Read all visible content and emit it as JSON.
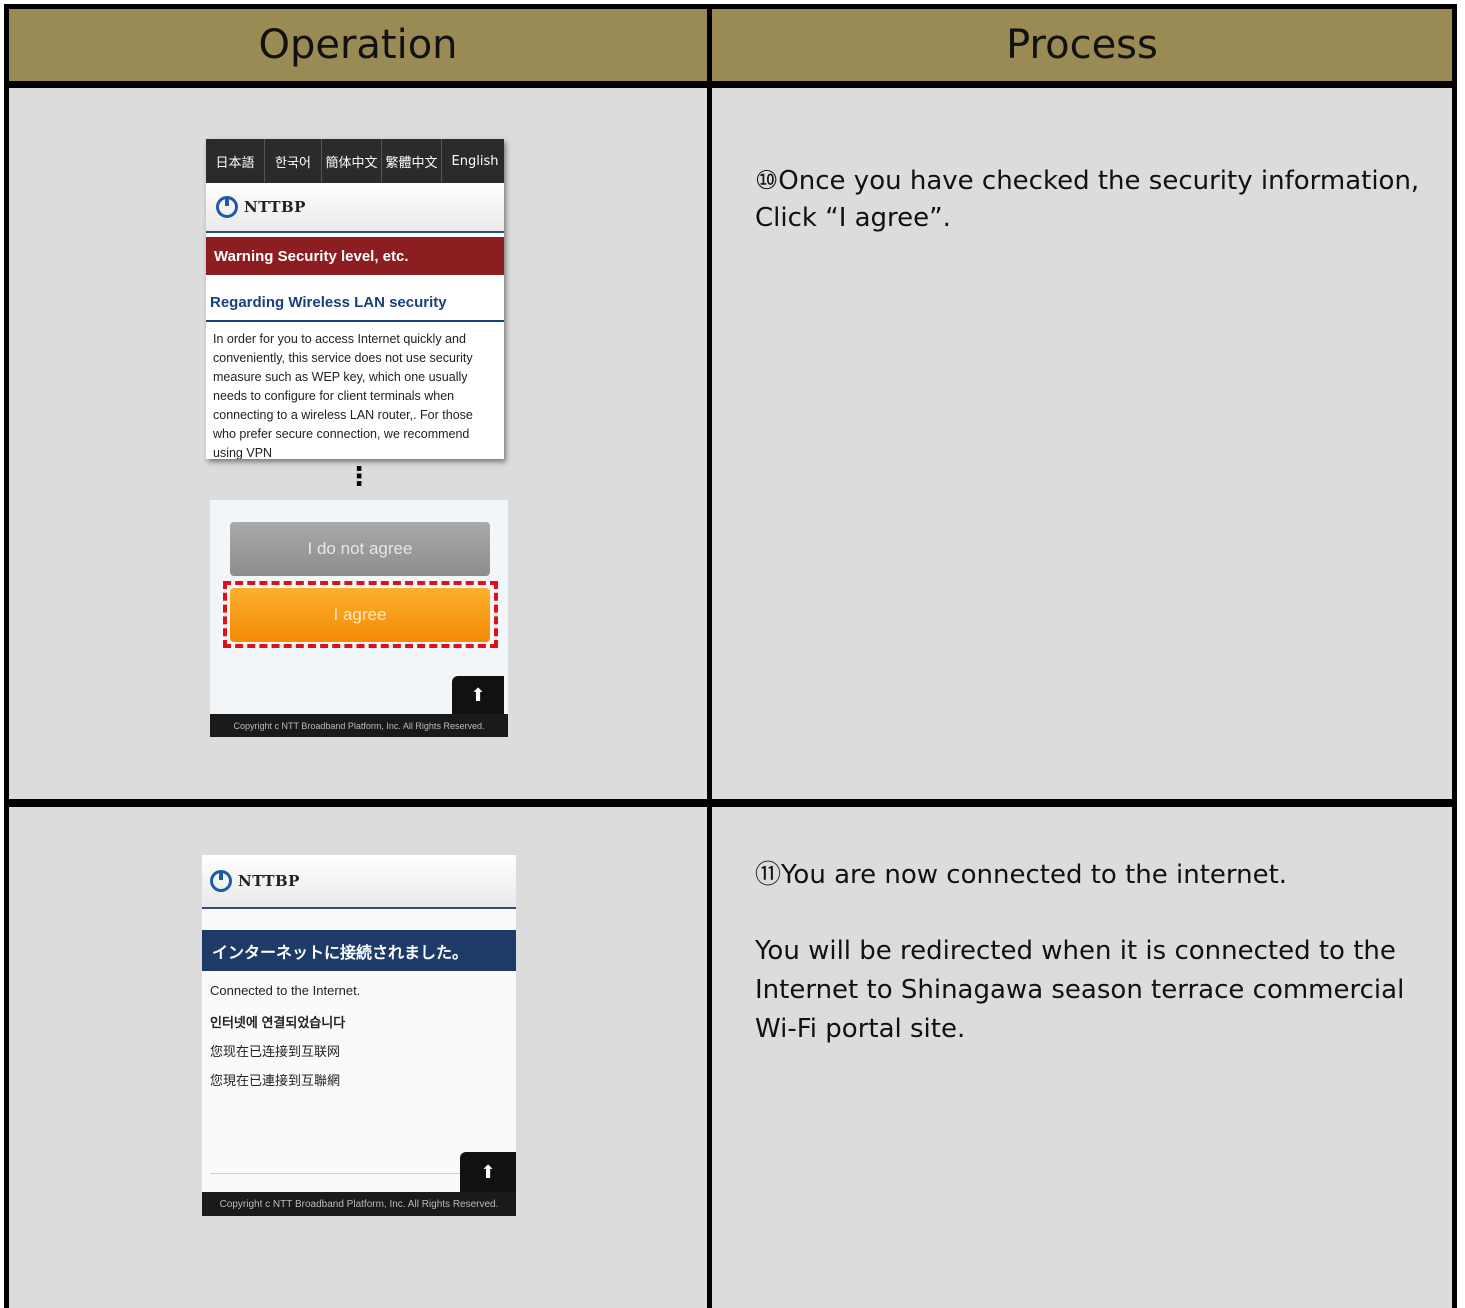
{
  "headers": {
    "operation": "Operation",
    "process": "Process"
  },
  "step10": {
    "screenshot": {
      "languages": [
        "日本語",
        "한국어",
        "簡体中文",
        "繁體中文",
        "English"
      ],
      "logo": "NTTBP",
      "warning_title": "Warning Security level, etc.",
      "section_title": "Regarding Wireless LAN security",
      "body": "In order for you to access Internet quickly and conveniently, this service does not use security measure such as WEP key, which one usually needs to configure for client terminals when connecting to a wireless LAN router,. For those who prefer secure connection, we recommend using VPN",
      "ellipsis": "⋮",
      "disagree_button": "I do not agree",
      "agree_button": "I agree",
      "scroll_top_icon": "arrow-up-icon",
      "copyright": "Copyright c NTT Broadband Platform, Inc. All Rights Reserved."
    },
    "process_text": "⑩Once you have checked the security information, Click “I agree”."
  },
  "step11": {
    "screenshot": {
      "logo": "NTTBP",
      "connected_title": "インターネットに接続されました。",
      "messages": [
        "Connected to the Internet.",
        "인터넷에 연결되었습니다",
        "您现在已连接到互联网",
        "您現在已連接到互聯網"
      ],
      "scroll_top_icon": "arrow-up-icon",
      "copyright": "Copyright c NTT Broadband Platform, Inc. All Rights Reserved."
    },
    "process_text_1": "⑪You are now connected to the internet.",
    "process_text_2": "You will be redirected when it is connected to the Internet to Shinagawa season terrace commercial Wi-Fi portal site."
  },
  "colors": {
    "header_bg": "#9a8a54",
    "cell_bg": "#dcdcdc",
    "warning_red": "#8c1d20",
    "brand_blue": "#1d3b67",
    "agree_orange": "#f79a10",
    "highlight_red": "#e0101a"
  }
}
